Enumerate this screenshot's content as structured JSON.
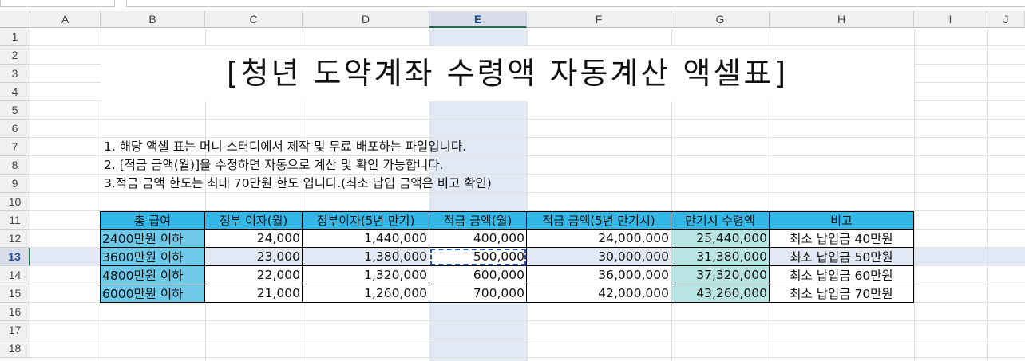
{
  "columns": [
    "A",
    "B",
    "C",
    "D",
    "E",
    "F",
    "G",
    "H",
    "I",
    "J"
  ],
  "rows": [
    "1",
    "2",
    "3",
    "4",
    "5",
    "6",
    "7",
    "8",
    "9",
    "10",
    "11",
    "12",
    "13",
    "14",
    "15",
    "16",
    "17",
    "18"
  ],
  "selected_column": "E",
  "selected_row": "13",
  "title": "[청년 도약계좌 수령액 자동계산 액셀표]",
  "notes": [
    "1. 해당 액셀 표는 머니 스터디에서 제작 및 무료 배포하는 파일입니다.",
    "2. [적금 금액(월)]을 수정하면 자동으로 계산 및 확인 가능합니다.",
    "3.적금 금액 한도는 최대 70만원 한도 입니다.(최소 납입 금액은 비고 확인)"
  ],
  "table": {
    "headers": [
      "총 급여",
      "정부 이자(월)",
      "정부이자(5년 만기)",
      "적금 금액(월)",
      "적금 금액(5년 만기시)",
      "만기시 수령액",
      "비고"
    ],
    "rows": [
      [
        "2400만원 이하",
        "24,000",
        "1,440,000",
        "400,000",
        "24,000,000",
        "25,440,000",
        "최소 납입금 40만원"
      ],
      [
        "3600만원 이하",
        "23,000",
        "1,380,000",
        "500,000",
        "30,000,000",
        "31,380,000",
        "최소 납입금 50만원"
      ],
      [
        "4800만원 이하",
        "22,000",
        "1,320,000",
        "600,000",
        "36,000,000",
        "37,320,000",
        "최소 납입금 60만원"
      ],
      [
        "6000만원 이하",
        "21,000",
        "1,260,000",
        "700,000",
        "42,000,000",
        "43,260,000",
        "최소 납입금 70만원"
      ]
    ]
  },
  "colors": {
    "header_fill": "#33b7e7",
    "first_col_fill": "#6ec9e8",
    "maturity_fill": "#b9e4e4",
    "selection_band": "#e3e8f5",
    "excel_green": "#217346"
  }
}
